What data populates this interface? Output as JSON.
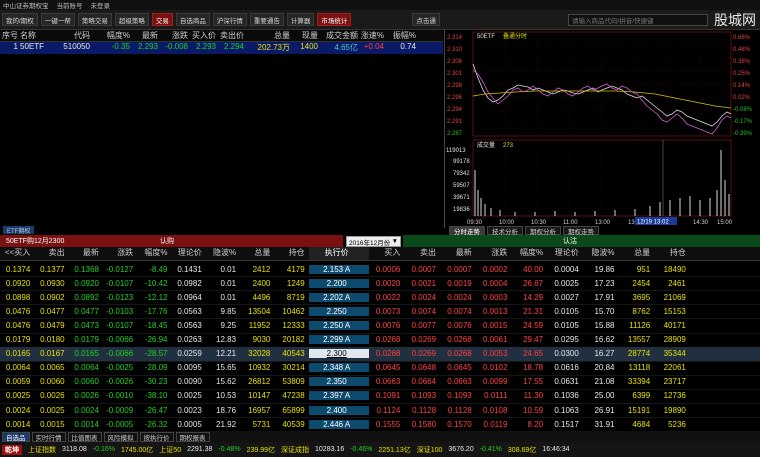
{
  "menu": [
    "中山证券期权宝",
    "当前账号",
    "未登录"
  ],
  "toolbar": {
    "items": [
      "我的/期权",
      "一键一帮",
      "策略交易",
      "超级策略",
      "交易",
      "自选商品",
      "沪深行情",
      "重要通告",
      "计算器",
      "市场统计"
    ],
    "right": "点击通",
    "search_placeholder": "请输入商品代码/拼音/快捷键",
    "logo": "股城网"
  },
  "quote": {
    "headers": [
      "序号",
      "名称",
      "代码",
      "幅度%",
      "最新",
      "涨跌",
      "买入价",
      "卖出价",
      "总量",
      "现量",
      "成交金额",
      "涨速%",
      "振幅%"
    ],
    "row": [
      "1",
      "50ETF",
      "510050",
      "-0.35",
      "2.293",
      "-0.008",
      "2.293",
      "2.294",
      "202.73万",
      "1400",
      "4.65亿",
      "+0.04",
      "0.74"
    ]
  },
  "etf_tab": "ETF期权",
  "chart": {
    "title": "50ETF",
    "mode": "叠通分时",
    "volume_label": "成交量",
    "volume_value": "273",
    "tooltip_date": "12/19 13:02",
    "left_ticks": [
      "2.314",
      "2.310",
      "2.306",
      "2.301",
      "2.298",
      "2.296",
      "2.294",
      "2.291",
      "2.287"
    ],
    "right_ticks": [
      "0.66%",
      "0.48%",
      "0.38%",
      "0.25%",
      "0.14%",
      "0.02%",
      "-0.08%",
      "-0.17%",
      "-0.39%"
    ],
    "vol_ticks": [
      "119013",
      "99178",
      "79342",
      "59507",
      "39671",
      "19836"
    ],
    "time_ticks": [
      "09:30",
      "10:00",
      "10:30",
      "11:00",
      "13:00",
      "13:30",
      "14:00",
      "14:30",
      "15:00"
    ],
    "tabs": [
      "分时走势",
      "技术分析",
      "期权分析",
      "期权走势"
    ]
  },
  "option": {
    "call_title": "50ETF购12月2300",
    "call_label": "认购",
    "put_label": "认沽",
    "month": "2016年12月份",
    "call_headers": [
      "<<买入",
      "卖出",
      "最新",
      "涨跌",
      "幅度%",
      "理论价",
      "隐波%",
      "总量",
      "持仓"
    ],
    "strike_header": "执行价",
    "put_headers": [
      "买入",
      "卖出",
      "最新",
      "涨跌",
      "幅度%",
      "理论价",
      "隐波%",
      "总量",
      "持仓"
    ],
    "rows": [
      {
        "c": [
          "0.1374",
          "0.1377",
          "0.1368",
          "-0.0127",
          "-8.49",
          "0.1431",
          "0.01",
          "2412",
          "4179"
        ],
        "k": "2.153 A",
        "p": [
          "0.0006",
          "0.0007",
          "0.0007",
          "0.0002",
          "40.00",
          "0.0004",
          "19.86",
          "951",
          "18490"
        ]
      },
      {
        "c": [
          "0.0920",
          "0.0930",
          "0.0920",
          "-0.0107",
          "-10.42",
          "0.0982",
          "0.01",
          "2400",
          "1249"
        ],
        "k": "2.200",
        "p": [
          "0.0020",
          "0.0021",
          "0.0019",
          "0.0004",
          "26.67",
          "0.0025",
          "17.23",
          "2454",
          "2461"
        ]
      },
      {
        "c": [
          "0.0898",
          "0.0902",
          "0.0892",
          "-0.0123",
          "-12.12",
          "0.0964",
          "0.01",
          "4496",
          "8719"
        ],
        "k": "2.202 A",
        "p": [
          "0.0022",
          "0.0024",
          "0.0024",
          "0.0003",
          "14.29",
          "0.0027",
          "17.91",
          "3695",
          "21069"
        ]
      },
      {
        "c": [
          "0.0476",
          "0.0477",
          "0.0477",
          "-0.0103",
          "-17.76",
          "0.0563",
          "9.85",
          "13504",
          "10462"
        ],
        "k": "2.250",
        "p": [
          "0.0073",
          "0.0074",
          "0.0074",
          "0.0013",
          "21.31",
          "0.0105",
          "15.70",
          "8762",
          "15153"
        ]
      },
      {
        "c": [
          "0.0476",
          "0.0479",
          "0.0473",
          "-0.0107",
          "-18.45",
          "0.0563",
          "9.25",
          "11952",
          "12333"
        ],
        "k": "2.250 A",
        "p": [
          "0.0076",
          "0.0077",
          "0.0076",
          "0.0015",
          "24.59",
          "0.0105",
          "15.88",
          "11126",
          "40171"
        ]
      },
      {
        "c": [
          "0.0179",
          "0.0180",
          "0.0179",
          "-0.0066",
          "-26.94",
          "0.0263",
          "12.83",
          "9030",
          "20182"
        ],
        "k": "2.299 A",
        "p": [
          "0.0268",
          "0.0269",
          "0.0268",
          "0.0061",
          "29.47",
          "0.0295",
          "16.62",
          "13557",
          "28909"
        ]
      },
      {
        "c": [
          "0.0165",
          "0.0167",
          "0.0165",
          "-0.0066",
          "-28.57",
          "0.0259",
          "12.21",
          "32028",
          "40543"
        ],
        "k": "2.300",
        "p": [
          "0.0268",
          "0.0269",
          "0.0268",
          "0.0053",
          "24.65",
          "0.0300",
          "16.27",
          "28774",
          "35344"
        ],
        "hl": true
      },
      {
        "c": [
          "0.0064",
          "0.0065",
          "0.0064",
          "-0.0025",
          "-28.09",
          "0.0095",
          "15.65",
          "10932",
          "30214"
        ],
        "k": "2.348 A",
        "p": [
          "0.0645",
          "0.0648",
          "0.0645",
          "0.0102",
          "18.78",
          "0.0616",
          "20.84",
          "13118",
          "22061"
        ]
      },
      {
        "c": [
          "0.0059",
          "0.0060",
          "0.0060",
          "-0.0026",
          "-30.23",
          "0.0090",
          "15.62",
          "26812",
          "53809"
        ],
        "k": "2.350",
        "p": [
          "0.0663",
          "0.0664",
          "0.0663",
          "0.0099",
          "17.55",
          "0.0631",
          "21.08",
          "33394",
          "23717"
        ]
      },
      {
        "c": [
          "0.0025",
          "0.0026",
          "0.0026",
          "-0.0010",
          "-38.10",
          "0.0025",
          "10.53",
          "10147",
          "47238"
        ],
        "k": "2.397 A",
        "p": [
          "0.1091",
          "0.1093",
          "0.1093",
          "0.0111",
          "11.30",
          "0.1036",
          "25.00",
          "6399",
          "12736"
        ]
      },
      {
        "c": [
          "0.0024",
          "0.0025",
          "0.0024",
          "-0.0009",
          "-26.47",
          "0.0023",
          "18.76",
          "16957",
          "65899"
        ],
        "k": "2.400",
        "p": [
          "0.1124",
          "0.1128",
          "0.1128",
          "0.0108",
          "10.59",
          "0.1063",
          "26.91",
          "15191",
          "19890"
        ]
      },
      {
        "c": [
          "0.0014",
          "0.0015",
          "0.0014",
          "-0.0005",
          "-26.32",
          "0.0005",
          "21.92",
          "5731",
          "40539"
        ],
        "k": "2.446 A",
        "p": [
          "0.1555",
          "0.1580",
          "0.1570",
          "0.0119",
          "8.20",
          "0.1517",
          "31.91",
          "4684",
          "5236"
        ]
      }
    ]
  },
  "bottom_tabs": [
    "自选品",
    "实时行情",
    "比值图表",
    "风险模拟",
    "按执行价",
    "期权报表"
  ],
  "status": {
    "brand": "乾坤",
    "items": [
      {
        "t": "上证指数",
        "c": "yellow"
      },
      {
        "t": "3118.08",
        "c": "white"
      },
      {
        "t": "-0.16%",
        "c": "green"
      },
      {
        "t": "1745.00亿",
        "c": "yellow"
      },
      {
        "t": "上证50",
        "c": "yellow"
      },
      {
        "t": "2291.38",
        "c": "white"
      },
      {
        "t": "-0.48%",
        "c": "green"
      },
      {
        "t": "239.99亿",
        "c": "yellow"
      },
      {
        "t": "深证成指",
        "c": "yellow"
      },
      {
        "t": "10283.16",
        "c": "white"
      },
      {
        "t": "-0.46%",
        "c": "green"
      },
      {
        "t": "2251.13亿",
        "c": "yellow"
      },
      {
        "t": "深证100",
        "c": "yellow"
      },
      {
        "t": "3676.20",
        "c": "white"
      },
      {
        "t": "-0.41%",
        "c": "green"
      },
      {
        "t": "308.69亿",
        "c": "yellow"
      },
      {
        "t": "16:46:34",
        "c": "white"
      }
    ]
  }
}
